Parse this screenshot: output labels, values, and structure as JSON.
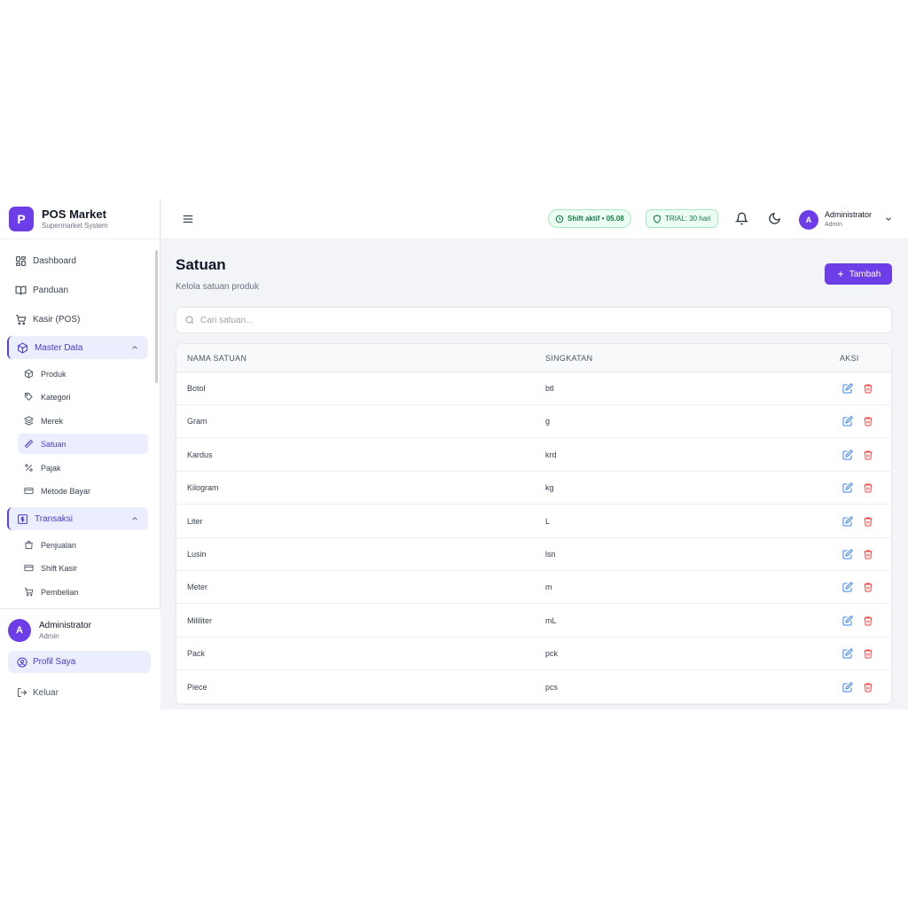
{
  "brand": {
    "logo_letter": "P",
    "title": "POS Market",
    "subtitle": "Supermarket System"
  },
  "sidebar": {
    "dashboard": "Dashboard",
    "panduan": "Panduan",
    "kasir": "Kasir (POS)",
    "master_data": {
      "label": "Master Data",
      "items": [
        "Produk",
        "Kategori",
        "Merek",
        "Satuan",
        "Pajak",
        "Metode Bayar"
      ],
      "active": "Satuan"
    },
    "transaksi": {
      "label": "Transaksi",
      "items": [
        "Penjualan",
        "Shift Kasir",
        "Pembelian"
      ]
    },
    "user": {
      "initial": "A",
      "name": "Administrator",
      "role": "Admin"
    },
    "profile_label": "Profil Saya",
    "logout_label": "Keluar"
  },
  "header": {
    "shift_badge": "Shift aktif • 05.08",
    "trial_badge": "TRIAL: 30 hari",
    "user": {
      "initial": "A",
      "name": "Administrator",
      "role": "Admin"
    }
  },
  "main": {
    "title": "Satuan",
    "subtitle": "Kelola satuan produk",
    "add_button": "Tambah",
    "search_placeholder": "Cari satuan...",
    "columns": [
      "NAMA SATUAN",
      "SINGKATAN",
      "AKSI"
    ],
    "rows": [
      [
        "Botol",
        "btl"
      ],
      [
        "Gram",
        "g"
      ],
      [
        "Kardus",
        "krd"
      ],
      [
        "Kilogram",
        "kg"
      ],
      [
        "Liter",
        "L"
      ],
      [
        "Lusin",
        "lsn"
      ],
      [
        "Meter",
        "m"
      ],
      [
        "Mililiter",
        "mL"
      ],
      [
        "Pack",
        "pck"
      ],
      [
        "Piece",
        "pcs"
      ]
    ]
  },
  "colors": {
    "accent": "#6d3de8",
    "active_bg": "#ebeefd",
    "edit": "#3b82f6",
    "delete": "#ef4444",
    "success": "#117a43"
  }
}
